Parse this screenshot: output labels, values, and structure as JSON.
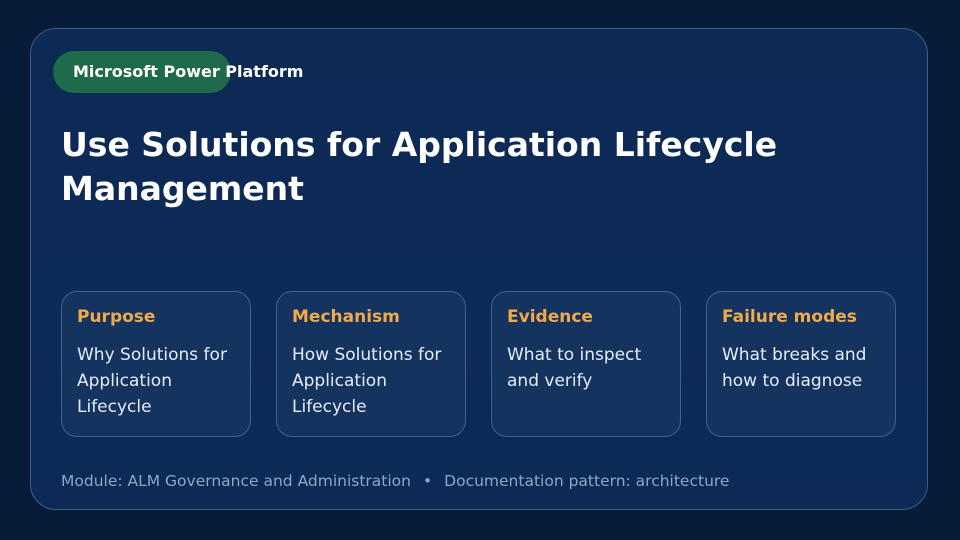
{
  "badge": "Microsoft Power Platform",
  "title": "Use Solutions for Application Lifecycle Management",
  "cards": [
    {
      "title": "Purpose",
      "body": "Why Solutions for Application Lifecycle"
    },
    {
      "title": "Mechanism",
      "body": "How Solutions for Application Lifecycle"
    },
    {
      "title": "Evidence",
      "body": "What to inspect and verify"
    },
    {
      "title": "Failure modes",
      "body": "What breaks and how to diagnose"
    }
  ],
  "footer": {
    "module": "Module: ALM Governance and Administration",
    "separator": "•",
    "pattern": "Documentation pattern: architecture"
  },
  "colors": {
    "background": "#081b38",
    "panel": "#0d2a55",
    "badge": "#1e6a4a",
    "card_title": "#f2a94a",
    "card_border": "#3f6290",
    "footer_text": "#8fa6c8"
  }
}
